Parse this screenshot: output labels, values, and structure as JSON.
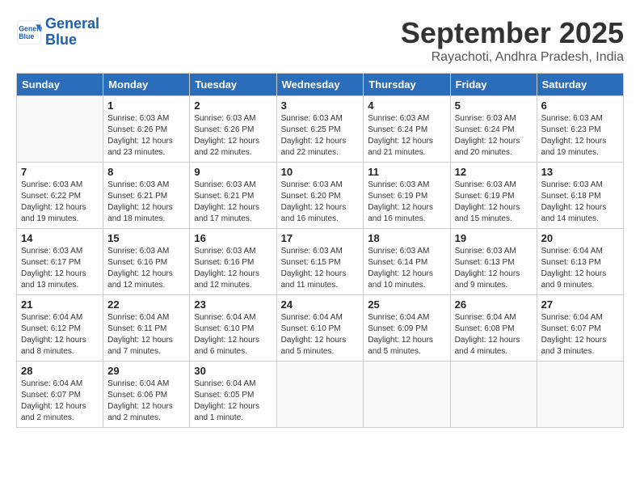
{
  "logo": {
    "line1": "General",
    "line2": "Blue"
  },
  "header": {
    "month": "September 2025",
    "location": "Rayachoti, Andhra Pradesh, India"
  },
  "weekdays": [
    "Sunday",
    "Monday",
    "Tuesday",
    "Wednesday",
    "Thursday",
    "Friday",
    "Saturday"
  ],
  "weeks": [
    [
      {
        "day": "",
        "info": ""
      },
      {
        "day": "1",
        "info": "Sunrise: 6:03 AM\nSunset: 6:26 PM\nDaylight: 12 hours\nand 23 minutes."
      },
      {
        "day": "2",
        "info": "Sunrise: 6:03 AM\nSunset: 6:26 PM\nDaylight: 12 hours\nand 22 minutes."
      },
      {
        "day": "3",
        "info": "Sunrise: 6:03 AM\nSunset: 6:25 PM\nDaylight: 12 hours\nand 22 minutes."
      },
      {
        "day": "4",
        "info": "Sunrise: 6:03 AM\nSunset: 6:24 PM\nDaylight: 12 hours\nand 21 minutes."
      },
      {
        "day": "5",
        "info": "Sunrise: 6:03 AM\nSunset: 6:24 PM\nDaylight: 12 hours\nand 20 minutes."
      },
      {
        "day": "6",
        "info": "Sunrise: 6:03 AM\nSunset: 6:23 PM\nDaylight: 12 hours\nand 19 minutes."
      }
    ],
    [
      {
        "day": "7",
        "info": "Sunrise: 6:03 AM\nSunset: 6:22 PM\nDaylight: 12 hours\nand 19 minutes."
      },
      {
        "day": "8",
        "info": "Sunrise: 6:03 AM\nSunset: 6:21 PM\nDaylight: 12 hours\nand 18 minutes."
      },
      {
        "day": "9",
        "info": "Sunrise: 6:03 AM\nSunset: 6:21 PM\nDaylight: 12 hours\nand 17 minutes."
      },
      {
        "day": "10",
        "info": "Sunrise: 6:03 AM\nSunset: 6:20 PM\nDaylight: 12 hours\nand 16 minutes."
      },
      {
        "day": "11",
        "info": "Sunrise: 6:03 AM\nSunset: 6:19 PM\nDaylight: 12 hours\nand 16 minutes."
      },
      {
        "day": "12",
        "info": "Sunrise: 6:03 AM\nSunset: 6:19 PM\nDaylight: 12 hours\nand 15 minutes."
      },
      {
        "day": "13",
        "info": "Sunrise: 6:03 AM\nSunset: 6:18 PM\nDaylight: 12 hours\nand 14 minutes."
      }
    ],
    [
      {
        "day": "14",
        "info": "Sunrise: 6:03 AM\nSunset: 6:17 PM\nDaylight: 12 hours\nand 13 minutes."
      },
      {
        "day": "15",
        "info": "Sunrise: 6:03 AM\nSunset: 6:16 PM\nDaylight: 12 hours\nand 12 minutes."
      },
      {
        "day": "16",
        "info": "Sunrise: 6:03 AM\nSunset: 6:16 PM\nDaylight: 12 hours\nand 12 minutes."
      },
      {
        "day": "17",
        "info": "Sunrise: 6:03 AM\nSunset: 6:15 PM\nDaylight: 12 hours\nand 11 minutes."
      },
      {
        "day": "18",
        "info": "Sunrise: 6:03 AM\nSunset: 6:14 PM\nDaylight: 12 hours\nand 10 minutes."
      },
      {
        "day": "19",
        "info": "Sunrise: 6:03 AM\nSunset: 6:13 PM\nDaylight: 12 hours\nand 9 minutes."
      },
      {
        "day": "20",
        "info": "Sunrise: 6:04 AM\nSunset: 6:13 PM\nDaylight: 12 hours\nand 9 minutes."
      }
    ],
    [
      {
        "day": "21",
        "info": "Sunrise: 6:04 AM\nSunset: 6:12 PM\nDaylight: 12 hours\nand 8 minutes."
      },
      {
        "day": "22",
        "info": "Sunrise: 6:04 AM\nSunset: 6:11 PM\nDaylight: 12 hours\nand 7 minutes."
      },
      {
        "day": "23",
        "info": "Sunrise: 6:04 AM\nSunset: 6:10 PM\nDaylight: 12 hours\nand 6 minutes."
      },
      {
        "day": "24",
        "info": "Sunrise: 6:04 AM\nSunset: 6:10 PM\nDaylight: 12 hours\nand 5 minutes."
      },
      {
        "day": "25",
        "info": "Sunrise: 6:04 AM\nSunset: 6:09 PM\nDaylight: 12 hours\nand 5 minutes."
      },
      {
        "day": "26",
        "info": "Sunrise: 6:04 AM\nSunset: 6:08 PM\nDaylight: 12 hours\nand 4 minutes."
      },
      {
        "day": "27",
        "info": "Sunrise: 6:04 AM\nSunset: 6:07 PM\nDaylight: 12 hours\nand 3 minutes."
      }
    ],
    [
      {
        "day": "28",
        "info": "Sunrise: 6:04 AM\nSunset: 6:07 PM\nDaylight: 12 hours\nand 2 minutes."
      },
      {
        "day": "29",
        "info": "Sunrise: 6:04 AM\nSunset: 6:06 PM\nDaylight: 12 hours\nand 2 minutes."
      },
      {
        "day": "30",
        "info": "Sunrise: 6:04 AM\nSunset: 6:05 PM\nDaylight: 12 hours\nand 1 minute."
      },
      {
        "day": "",
        "info": ""
      },
      {
        "day": "",
        "info": ""
      },
      {
        "day": "",
        "info": ""
      },
      {
        "day": "",
        "info": ""
      }
    ]
  ]
}
